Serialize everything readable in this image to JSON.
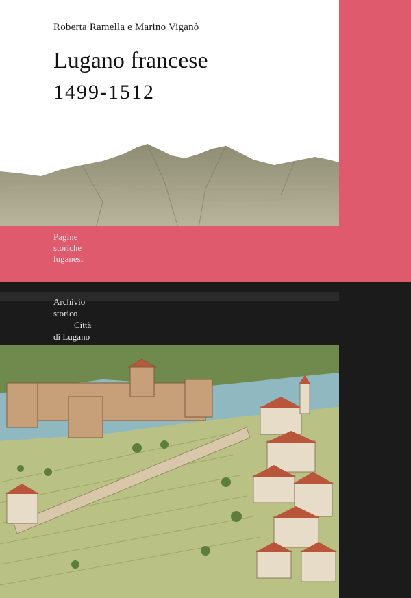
{
  "cover": {
    "authors": "Roberta Ramella e Marino Viganò",
    "title": "Lugano francese",
    "years": "1499-1512",
    "series": [
      "Pagine",
      "storiche",
      "luganesi"
    ],
    "publisher": [
      "Archivio",
      "storico",
      "Città",
      "di Lugano"
    ]
  },
  "colors": {
    "pink": "#e05a6e",
    "dark": "#1b1b1b",
    "mountain": "#9c9a80",
    "lake": "#8fb8c0"
  },
  "illustrations": {
    "top": "mountain-landscape",
    "bottom": "lugano-castle-town-aerial"
  }
}
